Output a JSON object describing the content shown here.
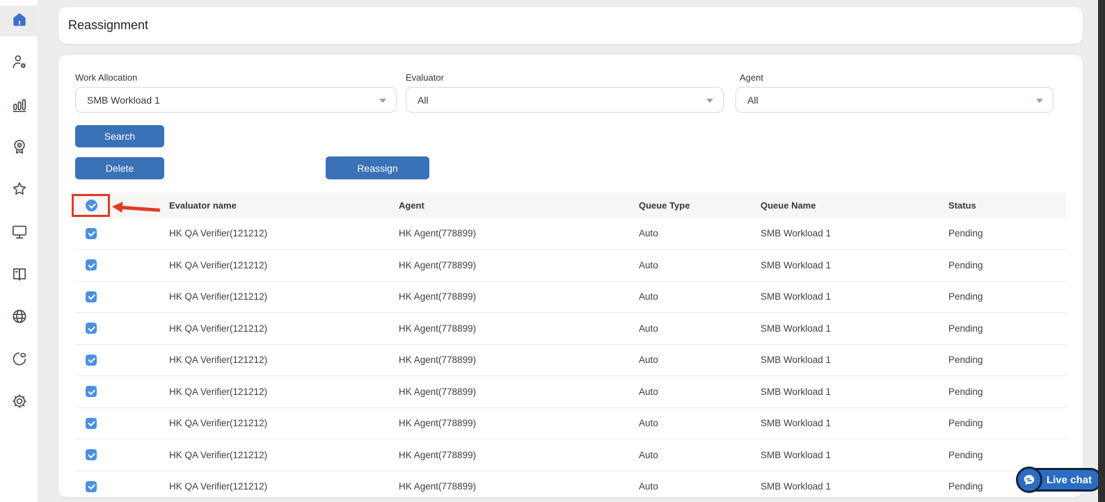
{
  "page": {
    "title": "Reassignment"
  },
  "sidebar": {
    "icons": [
      "home-icon",
      "user-settings-icon",
      "bar-chart-icon",
      "quality-badge-icon",
      "star-icon",
      "monitor-icon",
      "book-icon",
      "globe-icon",
      "pie-chart-icon",
      "gear-icon"
    ],
    "active": "home-icon"
  },
  "filters": {
    "work_allocation": {
      "label": "Work Allocation",
      "value": "SMB Workload 1"
    },
    "evaluator": {
      "label": "Evaluator",
      "value": "All"
    },
    "agent": {
      "label": "Agent",
      "value": "All"
    }
  },
  "buttons": {
    "search": "Search",
    "delete": "Delete",
    "reassign": "Reassign"
  },
  "table": {
    "header_checkbox_checked": true,
    "columns": [
      "Evaluator name",
      "Agent",
      "Queue Type",
      "Queue Name",
      "Status"
    ],
    "rows": [
      {
        "checked": true,
        "evaluator": "HK QA Verifier(121212)",
        "agent": "HK Agent(778899)",
        "queue_type": "Auto",
        "queue_name": "SMB Workload 1",
        "status": "Pending"
      },
      {
        "checked": true,
        "evaluator": "HK QA Verifier(121212)",
        "agent": "HK Agent(778899)",
        "queue_type": "Auto",
        "queue_name": "SMB Workload 1",
        "status": "Pending"
      },
      {
        "checked": true,
        "evaluator": "HK QA Verifier(121212)",
        "agent": "HK Agent(778899)",
        "queue_type": "Auto",
        "queue_name": "SMB Workload 1",
        "status": "Pending"
      },
      {
        "checked": true,
        "evaluator": "HK QA Verifier(121212)",
        "agent": "HK Agent(778899)",
        "queue_type": "Auto",
        "queue_name": "SMB Workload 1",
        "status": "Pending"
      },
      {
        "checked": true,
        "evaluator": "HK QA Verifier(121212)",
        "agent": "HK Agent(778899)",
        "queue_type": "Auto",
        "queue_name": "SMB Workload 1",
        "status": "Pending"
      },
      {
        "checked": true,
        "evaluator": "HK QA Verifier(121212)",
        "agent": "HK Agent(778899)",
        "queue_type": "Auto",
        "queue_name": "SMB Workload 1",
        "status": "Pending"
      },
      {
        "checked": true,
        "evaluator": "HK QA Verifier(121212)",
        "agent": "HK Agent(778899)",
        "queue_type": "Auto",
        "queue_name": "SMB Workload 1",
        "status": "Pending"
      },
      {
        "checked": true,
        "evaluator": "HK QA Verifier(121212)",
        "agent": "HK Agent(778899)",
        "queue_type": "Auto",
        "queue_name": "SMB Workload 1",
        "status": "Pending"
      },
      {
        "checked": true,
        "evaluator": "HK QA Verifier(121212)",
        "agent": "HK Agent(778899)",
        "queue_type": "Auto",
        "queue_name": "SMB Workload 1",
        "status": "Pending"
      }
    ]
  },
  "live_chat": {
    "label": "Live chat"
  },
  "colors": {
    "button_blue": "#3a72b8",
    "checkbox_blue": "#4a90e2",
    "home_icon_blue": "#3d6fd0",
    "live_chat_blue": "#2b6dc0",
    "live_chat_outline": "#10223e",
    "annotation_red": "#e23a23",
    "page_background": "#ecedef",
    "table_header_background": "#f8f6f4"
  }
}
